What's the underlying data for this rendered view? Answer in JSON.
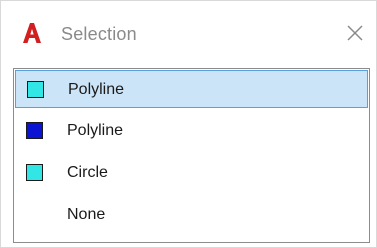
{
  "window": {
    "title": "Selection",
    "app_icon": "autocad-a-icon",
    "close_icon": "close-icon"
  },
  "list": {
    "items": [
      {
        "label": "Polyline",
        "swatch_color": "#33e6e6",
        "selected": true
      },
      {
        "label": "Polyline",
        "swatch_color": "#0a14d2",
        "selected": false
      },
      {
        "label": "Circle",
        "swatch_color": "#33e6e6",
        "selected": false
      },
      {
        "label": "None",
        "swatch_color": null,
        "selected": false
      }
    ],
    "selection_highlight": "#cce4f7",
    "selection_border": "#5aa0db"
  },
  "colors": {
    "brand_red": "#d22020",
    "title_gray": "#8a8a8a"
  }
}
